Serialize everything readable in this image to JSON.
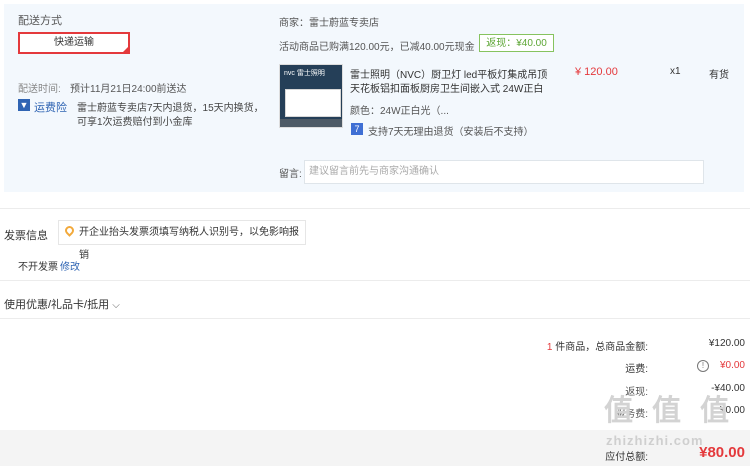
{
  "shipping": {
    "title": "配送方式",
    "method_button": "快递运输",
    "time_label": "配送时间:",
    "time_value": "预计11月21日24:00前送达",
    "insurance_link": "运费险",
    "insurance_text_line1": "雷士蔚蓝专卖店7天内退货，15天内换货，",
    "insurance_text_line2": "可享1次运费赔付到小金库"
  },
  "store": {
    "merchant_line": "商家：雷士蔚蓝专卖店",
    "promo": "活动商品已购满120.00元，已减40.00元现金",
    "rebate_tag": "返现：¥40.00"
  },
  "product": {
    "thumb_brand": "nvc 雷士照明",
    "title_line1": "雷士照明（NVC）厨卫灯 led平板灯集成吊顶",
    "title_line2": "天花板铝扣面板厨房卫生间嵌入式 24W正白",
    "color_label": "颜色：24W正白光（...",
    "price": "¥ 120.00",
    "quantity": "x1",
    "stock": "有货",
    "return_policy": "支持7天无理由退货（安装后不支持）"
  },
  "note": {
    "label": "留言:",
    "placeholder": "建议留言前先与商家沟通确认"
  },
  "invoice": {
    "title": "发票信息",
    "tip": "开企业抬头发票须填写纳税人识别号，以免影响报销",
    "status": "不开发票",
    "modify_link": "修改"
  },
  "discount": {
    "title": "使用优惠/礼品卡/抵用"
  },
  "summary": {
    "item_count": "1",
    "item_count_text": "件商品，总商品金额:",
    "total_goods": "¥120.00",
    "shipping_label": "运费:",
    "shipping_fee": "¥0.00",
    "rebate_label": "返现:",
    "rebate_value": "-¥40.00",
    "service_label": "服务费:",
    "service_value": "¥0.00",
    "payable_label": "应付总额:",
    "payable_value": "¥80.00"
  },
  "watermark": {
    "glyphs": [
      "值",
      "值",
      "值"
    ],
    "site": "zhizhizhi.com"
  },
  "colors": {
    "accent_red": "#e4393c",
    "link_blue": "#2f64b3",
    "rebate_green": "#5da635",
    "panel_bg": "#f3f8fd"
  }
}
